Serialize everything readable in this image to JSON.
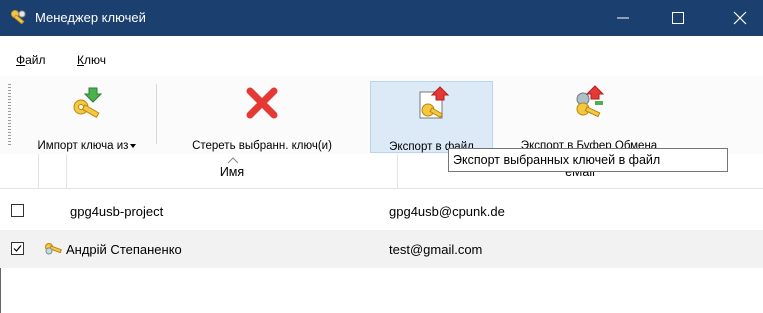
{
  "window": {
    "title": "Менеджер ключей",
    "app_icon": "key-manager-icon",
    "accent": "#1b3f6e"
  },
  "menu": {
    "file_first": "Ф",
    "file_rest": "айл",
    "key_first": "К",
    "key_rest": "люч"
  },
  "toolbar": {
    "import_label": "Импорт ключа из",
    "erase_label": "Стереть выбранн. ключ(и)",
    "export_file_label": "Экспорт в файл",
    "export_clipboard_label": "Экспорт в Буфер Обмена"
  },
  "tooltip": "Экспорт выбранных ключей в файл",
  "table": {
    "columns": [
      "Имя",
      "eMail"
    ],
    "rows": [
      {
        "checked": false,
        "name": "gpg4usb-project",
        "email": "gpg4usb@cpunk.de"
      },
      {
        "checked": true,
        "name": "Андрій Степаненко",
        "email": "test@gmail.com"
      }
    ]
  }
}
